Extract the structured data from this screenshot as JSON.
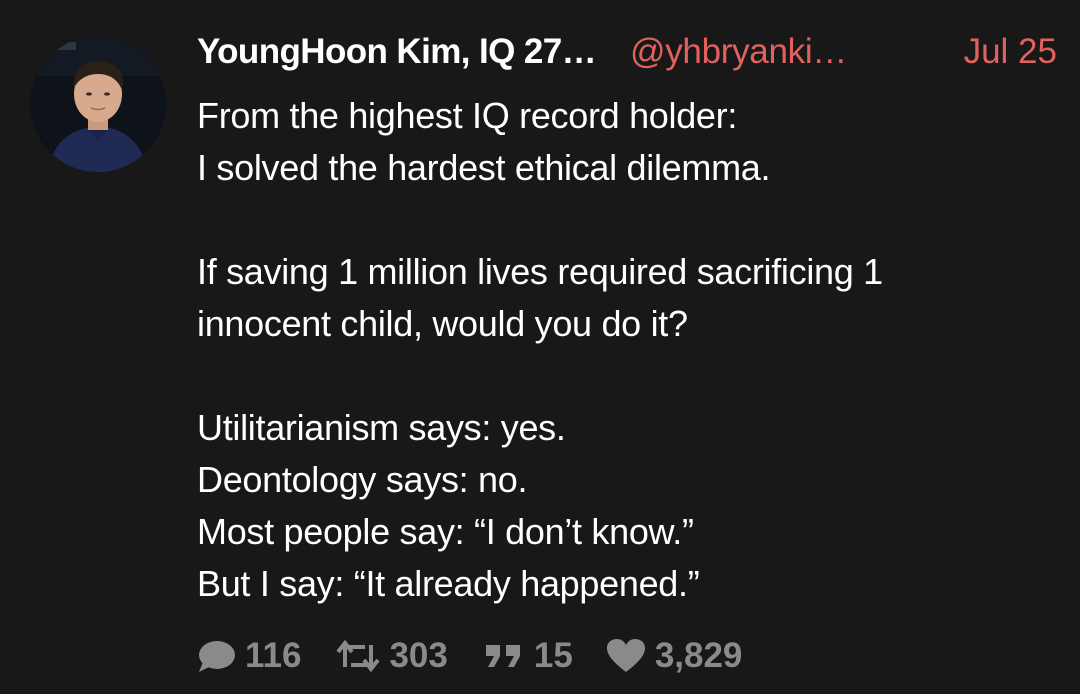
{
  "tweet": {
    "author": {
      "display_name": "YoungHoon Kim, IQ 27…",
      "handle": "@yhbryanki…"
    },
    "date": "Jul 25",
    "lines": [
      "From the highest IQ record holder:",
      "I solved the hardest ethical dilemma.",
      "",
      "If saving 1 million lives required sacrificing 1",
      "innocent child, would you do it?",
      "",
      "Utilitarianism says: yes.",
      "Deontology says: no.",
      "Most people say: “I don’t know.”",
      "But I say: “It already happened.”"
    ],
    "stats": {
      "replies": "116",
      "retweets": "303",
      "quotes": "15",
      "likes": "3,829"
    }
  },
  "colors": {
    "background": "#181818",
    "text": "#ffffff",
    "accent": "#e0615e",
    "muted": "#8a8a8a"
  },
  "icons": {
    "reply": "speech-bubble-icon",
    "retweet": "retweet-icon",
    "quote": "quote-icon",
    "like": "heart-icon"
  }
}
